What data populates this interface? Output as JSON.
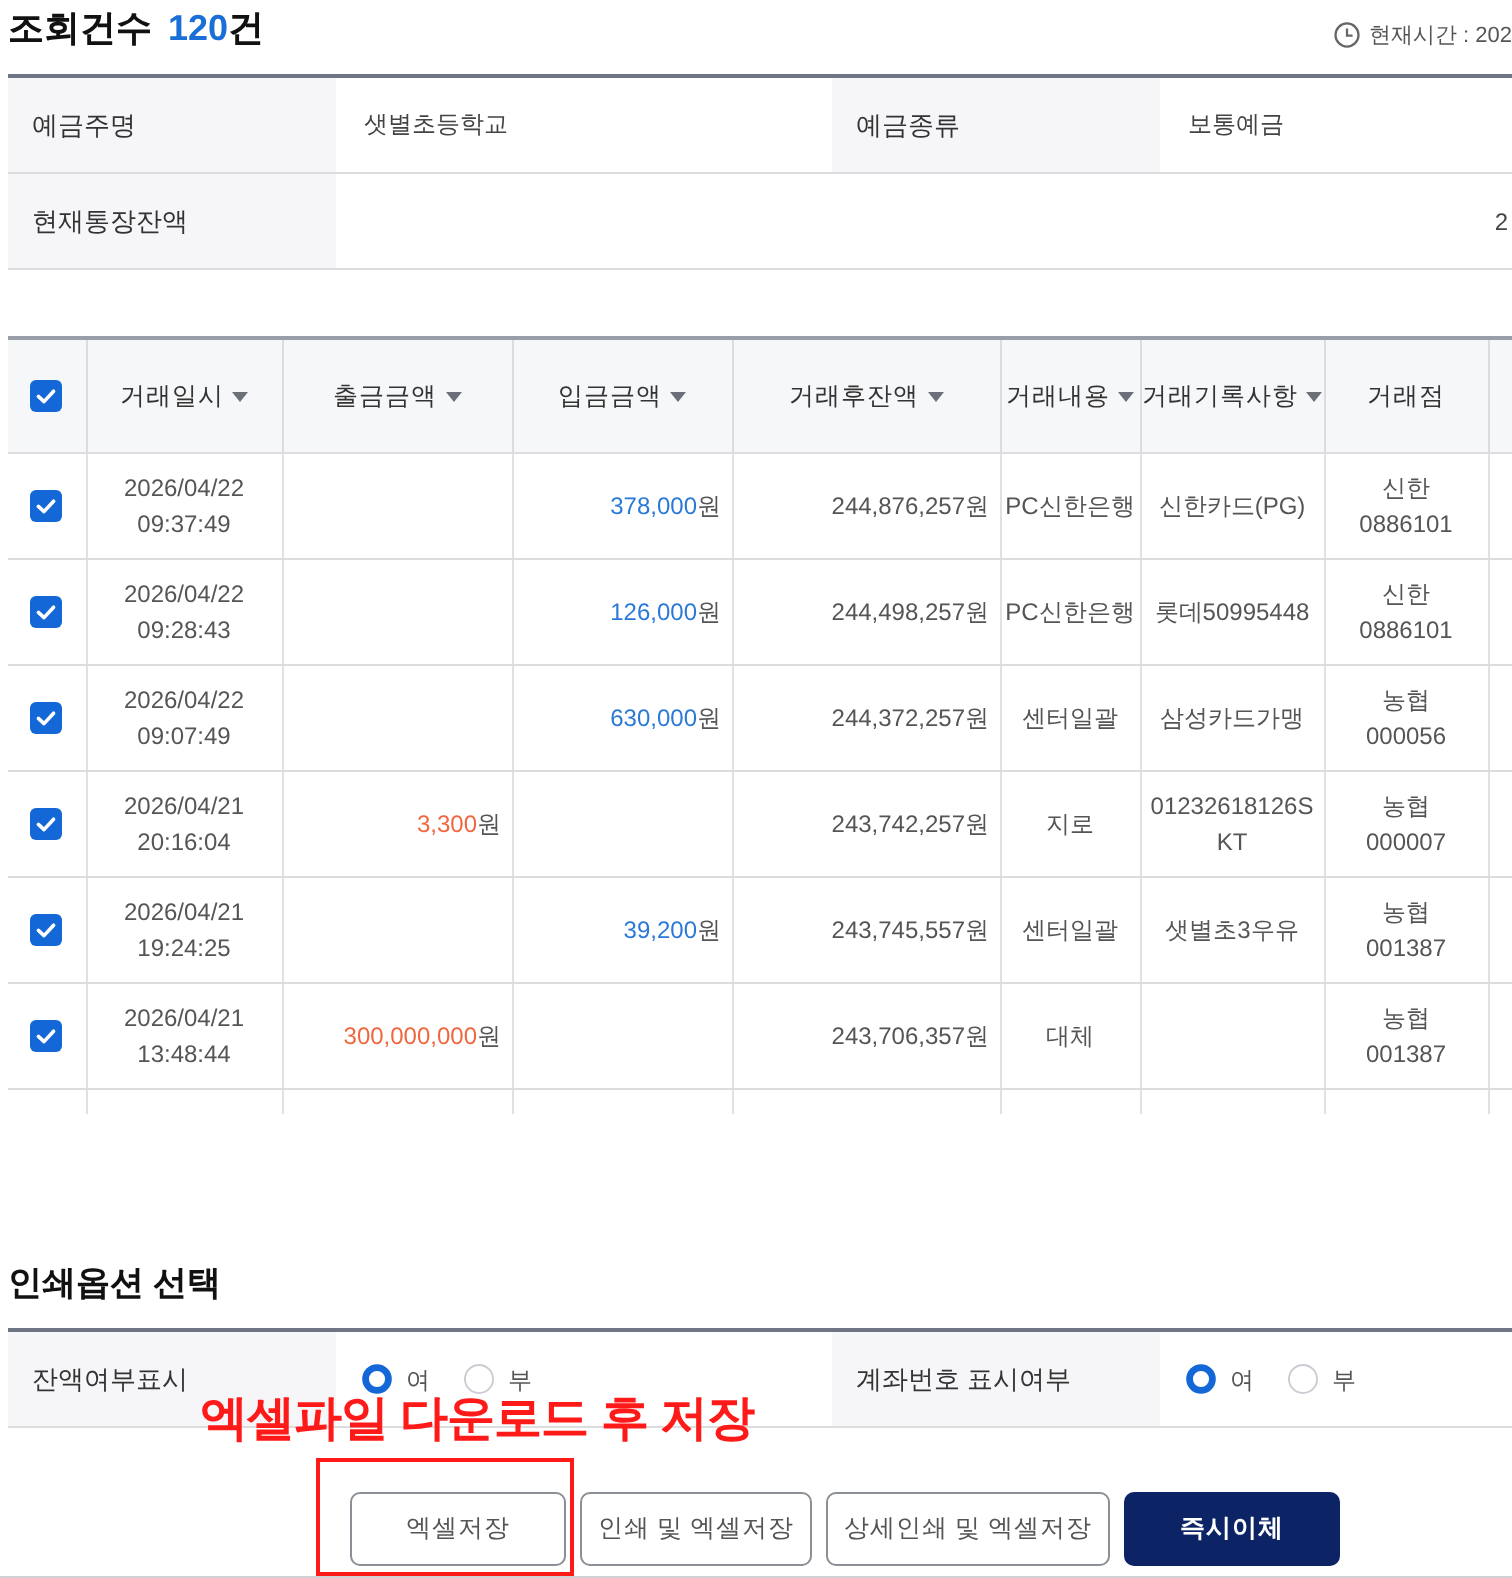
{
  "header": {
    "title": "조회건수",
    "count": "120",
    "count_unit": "건",
    "current_time": "현재시간 : 202"
  },
  "account_info": {
    "rows": [
      [
        {
          "label": "예금주명",
          "value": "샛별초등학교"
        },
        {
          "label": "예금종류",
          "value": "보통예금"
        }
      ],
      [
        {
          "label": "현재통장잔액",
          "value": "2"
        }
      ]
    ]
  },
  "transactions": {
    "select_all": {
      "checked": true
    },
    "columns": [
      {
        "label": "거래일시",
        "sortable": true
      },
      {
        "label": "출금금액",
        "sortable": true
      },
      {
        "label": "입금금액",
        "sortable": true
      },
      {
        "label": "거래후잔액",
        "sortable": true
      },
      {
        "label": "거래내용",
        "sortable": true
      },
      {
        "label": "거래기록사항",
        "sortable": true
      },
      {
        "label": "거래점",
        "sortable": false
      }
    ],
    "rows": [
      {
        "checked": true,
        "date": "2026/04/22",
        "time": "09:37:49",
        "deposit": {
          "amount": "378,000",
          "unit": "원"
        },
        "balance": "244,876,257원",
        "type": "PC신한은행",
        "memo": "신한카드(PG)",
        "branch": {
          "bank": "신한",
          "code": "0886101"
        }
      },
      {
        "checked": true,
        "date": "2026/04/22",
        "time": "09:28:43",
        "deposit": {
          "amount": "126,000",
          "unit": "원"
        },
        "balance": "244,498,257원",
        "type": "PC신한은행",
        "memo": "롯데50995448",
        "branch": {
          "bank": "신한",
          "code": "0886101"
        }
      },
      {
        "checked": true,
        "date": "2026/04/22",
        "time": "09:07:49",
        "deposit": {
          "amount": "630,000",
          "unit": "원"
        },
        "balance": "244,372,257원",
        "type": "센터일괄",
        "memo": "삼성카드가맹",
        "branch": {
          "bank": "농협",
          "code": "000056"
        }
      },
      {
        "checked": true,
        "date": "2026/04/21",
        "time": "20:16:04",
        "withdrawal": {
          "amount": "3,300",
          "unit": "원"
        },
        "balance": "243,742,257원",
        "type": "지로",
        "memo": "01232618126SKT",
        "branch": {
          "bank": "농협",
          "code": "000007"
        }
      },
      {
        "checked": true,
        "date": "2026/04/21",
        "time": "19:24:25",
        "deposit": {
          "amount": "39,200",
          "unit": "원"
        },
        "balance": "243,745,557원",
        "type": "센터일괄",
        "memo": "샛별초3우유",
        "branch": {
          "bank": "농협",
          "code": "001387"
        }
      },
      {
        "checked": true,
        "date": "2026/04/21",
        "time": "13:48:44",
        "withdrawal": {
          "amount": "300,000,000",
          "unit": "원"
        },
        "balance": "243,706,357원",
        "type": "대체",
        "branch": {
          "bank": "농협",
          "code": "001387"
        }
      }
    ]
  },
  "print_options": {
    "title": "인쇄옵션 선택",
    "options": [
      {
        "label": "잔액여부표시",
        "choices": [
          {
            "label": "여",
            "selected": true
          },
          {
            "label": "부",
            "selected": false
          }
        ]
      },
      {
        "label": "계좌번호 표시여부",
        "choices": [
          {
            "label": "여",
            "selected": true
          },
          {
            "label": "부",
            "selected": false
          }
        ]
      }
    ]
  },
  "actions": {
    "buttons": [
      {
        "label": "엑셀저장",
        "kind": "secondary",
        "highlighted": true
      },
      {
        "label": "인쇄 및 엑셀저장",
        "kind": "secondary",
        "highlighted": false
      },
      {
        "label": "상세인쇄 및 엑셀저장",
        "kind": "secondary",
        "highlighted": false
      },
      {
        "label": "즉시이체",
        "kind": "primary",
        "highlighted": false
      }
    ]
  },
  "annotation": {
    "text": "엑셀파일 다운로드 후 저장"
  }
}
